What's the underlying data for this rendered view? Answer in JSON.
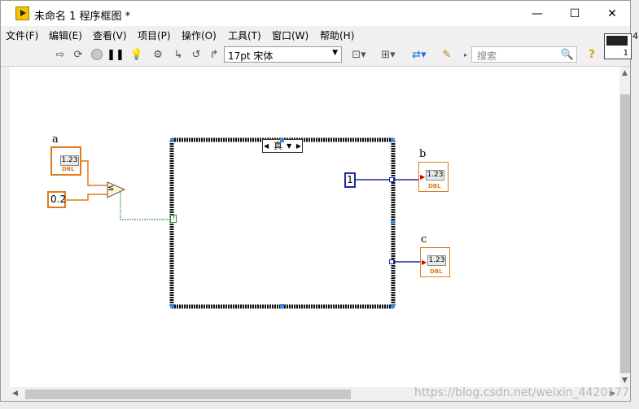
{
  "window": {
    "title": "未命名 1 程序框图 *"
  },
  "menu": [
    "文件(F)",
    "编辑(E)",
    "查看(V)",
    "项目(P)",
    "操作(O)",
    "工具(T)",
    "窗口(W)",
    "帮助(H)"
  ],
  "toolbar": {
    "font": "17pt 宋体",
    "search_placeholder": "搜索"
  },
  "diagram": {
    "input_a": {
      "label": "a",
      "display": "1.23",
      "type": "DBL"
    },
    "constant": "0.2",
    "compare_symbol": "≤",
    "case_selector": "真",
    "case_constant": "1",
    "indicator_b": {
      "label": "b",
      "display": "1.23",
      "type": "DBL"
    },
    "indicator_c": {
      "label": "c",
      "display": "1.23",
      "type": "DBL"
    },
    "selector_terminal": "?"
  },
  "side_icon_number": "1",
  "edge_text": {
    "left_a": "a",
    "left_b": "编",
    "right": "4:"
  },
  "watermark": "https://blog.csdn.net/weixin_4420177"
}
